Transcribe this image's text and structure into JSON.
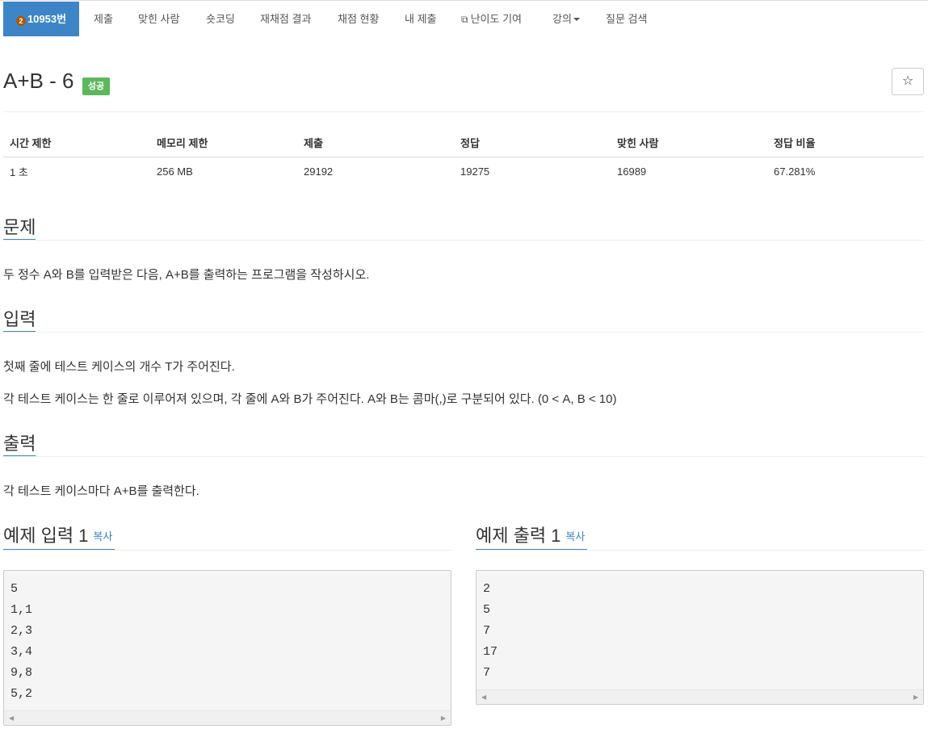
{
  "nav": {
    "problem_number": "10953번",
    "tier_glyph": "2",
    "items": [
      "제출",
      "맞힌 사람",
      "숏코딩",
      "재채점 결과",
      "채점 현황",
      "내 제출",
      "난이도 기여",
      "강의",
      "질문 검색"
    ]
  },
  "title": "A+B - 6",
  "status_badge": "성공",
  "star_glyph": "☆",
  "info": {
    "headers": [
      "시간 제한",
      "메모리 제한",
      "제출",
      "정답",
      "맞힌 사람",
      "정답 비율"
    ],
    "values": [
      "1 초",
      "256 MB",
      "29192",
      "19275",
      "16989",
      "67.281%"
    ]
  },
  "sections": {
    "problem": {
      "heading": "문제",
      "text": "두 정수 A와 B를 입력받은 다음, A+B를 출력하는 프로그램을 작성하시오."
    },
    "input": {
      "heading": "입력",
      "lines": [
        "첫째 줄에 테스트 케이스의 개수 T가 주어진다.",
        "각 테스트 케이스는 한 줄로 이루어져 있으며, 각 줄에 A와 B가 주어진다. A와 B는 콤마(,)로 구분되어 있다. (0 < A, B < 10)"
      ]
    },
    "output": {
      "heading": "출력",
      "text": "각 테스트 케이스마다 A+B를 출력한다."
    }
  },
  "samples": {
    "input": {
      "heading": "예제 입력 1",
      "copy": "복사",
      "content": "5\n1,1\n2,3\n3,4\n9,8\n5,2"
    },
    "output": {
      "heading": "예제 출력 1",
      "copy": "복사",
      "content": "2\n5\n7\n17\n7"
    }
  },
  "colors": {
    "accent": "#3d85c6",
    "success": "#5cb85c",
    "tier": "#ad5600"
  }
}
